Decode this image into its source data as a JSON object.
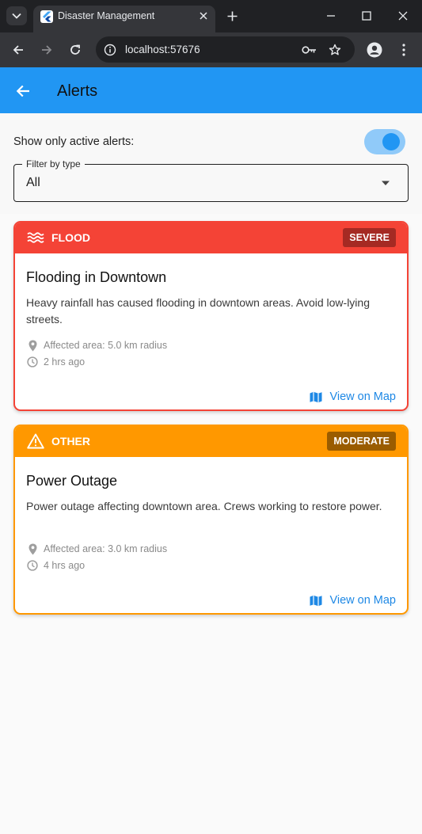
{
  "browser": {
    "tab_title": "Disaster Management",
    "url": "localhost:57676"
  },
  "app": {
    "title": "Alerts",
    "colors": {
      "appbar": "#2196f3",
      "flood": "#f44336",
      "other": "#ff9800",
      "link": "#1e88e5"
    }
  },
  "filters": {
    "active_only_label": "Show only active alerts:",
    "active_only_on": true,
    "type_filter_label": "Filter by type",
    "type_filter_value": "All"
  },
  "alerts": [
    {
      "type": "FLOOD",
      "type_icon": "waves-icon",
      "severity": "SEVERE",
      "title": "Flooding in Downtown",
      "description": "Heavy rainfall has caused flooding in downtown areas. Avoid low-lying streets.",
      "affected_area": "Affected area: 5.0 km radius",
      "time_ago": "2 hrs ago",
      "map_link": "View on Map"
    },
    {
      "type": "OTHER",
      "type_icon": "warning-icon",
      "severity": "MODERATE",
      "title": "Power Outage",
      "description": "Power outage affecting downtown area. Crews working to restore power.",
      "affected_area": "Affected area: 3.0 km radius",
      "time_ago": "4 hrs ago",
      "map_link": "View on Map"
    }
  ]
}
